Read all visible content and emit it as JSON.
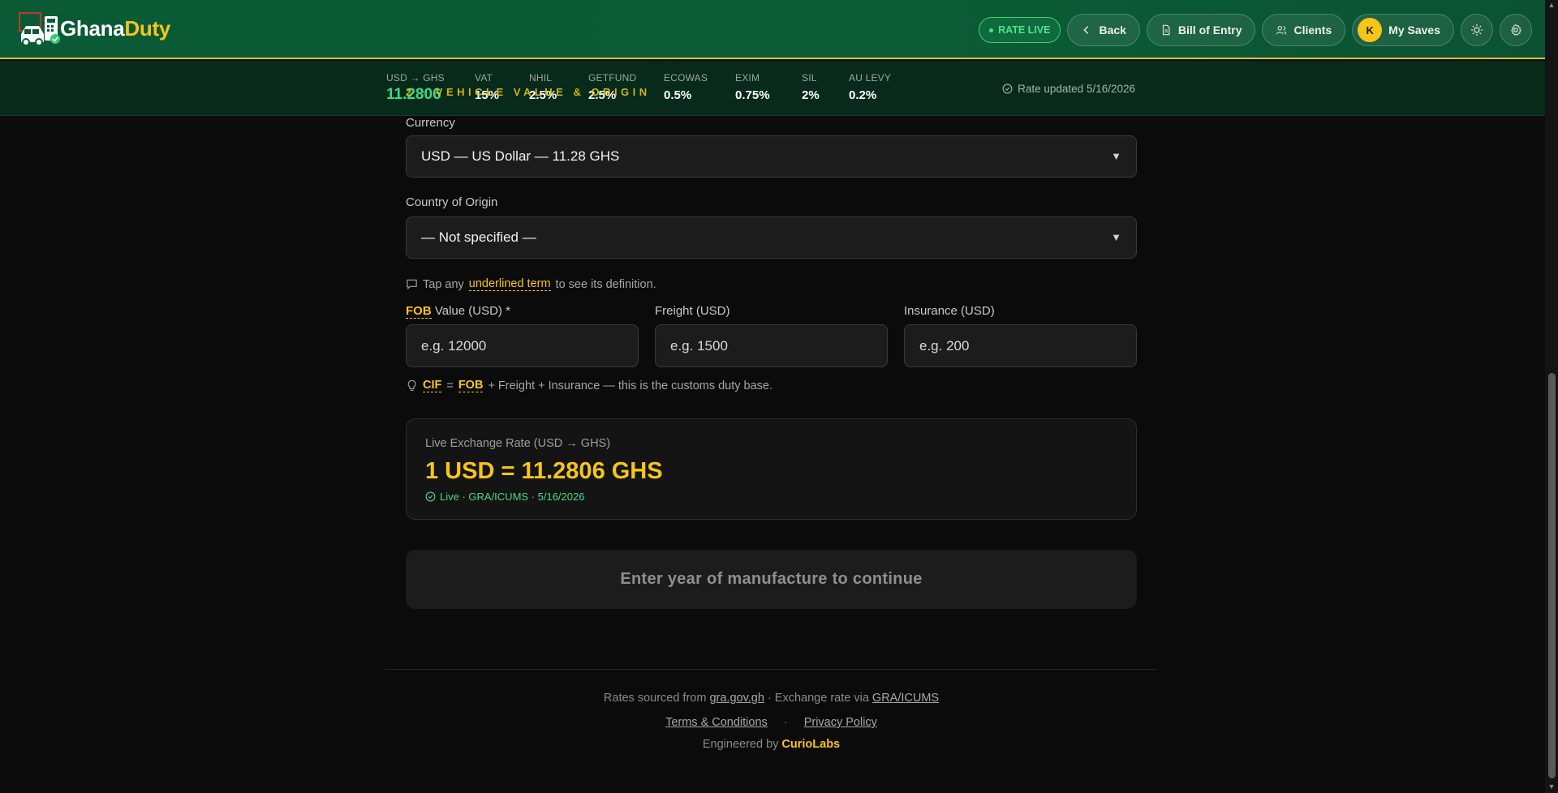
{
  "brand": {
    "name_part1": "Ghana",
    "name_part2": "Duty"
  },
  "header": {
    "rate_live": "RATE LIVE",
    "back": "Back",
    "bill_of_entry": "Bill of Entry",
    "clients": "Clients",
    "avatar_initial": "K",
    "my_saves": "My Saves"
  },
  "rates": {
    "pair_label": "USD → GHS",
    "pair_value": "11.2806",
    "items": [
      {
        "label": "VAT",
        "value": "15%"
      },
      {
        "label": "NHIL",
        "value": "2.5%"
      },
      {
        "label": "GETFUND",
        "value": "2.5%"
      },
      {
        "label": "ECOWAS",
        "value": "0.5%"
      },
      {
        "label": "EXIM",
        "value": "0.75%"
      },
      {
        "label": "SIL",
        "value": "2%"
      },
      {
        "label": "AU LEVY",
        "value": "0.2%"
      }
    ],
    "updated": "Rate updated 5/16/2026",
    "section_overlay": "2 · VEHICLE VALUE & ORIGIN"
  },
  "form": {
    "currency_label": "Currency",
    "currency_value": "USD — US Dollar — 11.28 GHS",
    "origin_label": "Country of Origin",
    "origin_value": "— Not specified —",
    "tap_hint_pre": "Tap any",
    "tap_hint_term": "underlined term",
    "tap_hint_post": "to see its definition.",
    "fob_term": "FOB",
    "fob_label_rest": "Value (USD) *",
    "fob_placeholder": "e.g. 12000",
    "freight_label": "Freight (USD)",
    "freight_placeholder": "e.g. 1500",
    "insurance_label": "Insurance (USD)",
    "insurance_placeholder": "e.g. 200",
    "cif_term": "CIF",
    "cif_eq": "=",
    "cif_fob_term": "FOB",
    "cif_rest": "+ Freight + Insurance — this is the customs duty base."
  },
  "exchange": {
    "label": "Live Exchange Rate (USD → GHS)",
    "value": "1 USD = 11.2806 GHS",
    "status": "Live · GRA/ICUMS · 5/16/2026"
  },
  "cta": {
    "label": "Enter year of manufacture to continue"
  },
  "footer": {
    "sourced_pre": "Rates sourced from",
    "sourced_link": "gra.gov.gh",
    "sourced_mid": "· Exchange rate via",
    "sourced_link2": "GRA/ICUMS",
    "terms": "Terms & Conditions",
    "sep": "·",
    "privacy": "Privacy Policy",
    "engineered_pre": "Engineered by",
    "engineered_brand": "CurioLabs"
  },
  "colors": {
    "header_green": "#0b5c37",
    "accent_yellow": "#f5c518",
    "live_green": "#4ee38a",
    "background": "#0b0b0b"
  },
  "icons": [
    "logo-icon",
    "chevron-left-icon",
    "document-icon",
    "users-icon",
    "sun-icon",
    "gear-icon",
    "check-circle-icon",
    "chat-icon",
    "lightbulb-icon"
  ]
}
